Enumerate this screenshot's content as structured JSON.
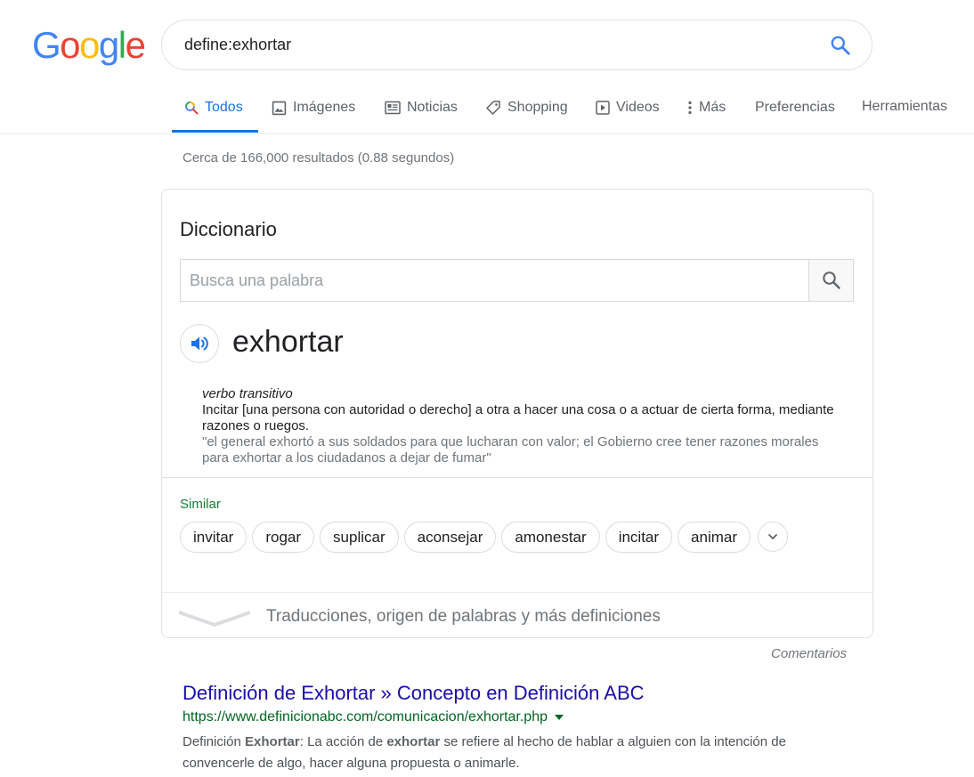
{
  "logo": {
    "letters": [
      "G",
      "o",
      "o",
      "g",
      "l",
      "e"
    ],
    "colors": [
      "#4285F4",
      "#EA4335",
      "#FBBC05",
      "#4285F4",
      "#34A853",
      "#EA4335"
    ]
  },
  "search": {
    "query": "define:exhortar"
  },
  "tabs": [
    {
      "label": "Todos",
      "icon": "search-icon",
      "active": true
    },
    {
      "label": "Imágenes",
      "icon": "image-icon"
    },
    {
      "label": "Noticias",
      "icon": "news-icon"
    },
    {
      "label": "Shopping",
      "icon": "tag-icon"
    },
    {
      "label": "Videos",
      "icon": "play-icon"
    },
    {
      "label": "Más",
      "icon": "more-vert-icon"
    },
    {
      "label": "Preferencias"
    },
    {
      "label": "Herramientas"
    }
  ],
  "stats": "Cerca de 166,000 resultados (0.88 segundos)",
  "dictionary": {
    "title": "Diccionario",
    "placeholder": "Busca una palabra",
    "word": "exhortar",
    "part_of_speech": "verbo transitivo",
    "definition": "Incitar [una persona con autoridad o derecho] a otra a hacer una cosa o a actuar de cierta forma, mediante razones o ruegos.",
    "example": "\"el general exhortó a sus soldados para que lucharan con valor; el Gobierno cree tener razones morales para exhortar a los ciudadanos a dejar de fumar\"",
    "similar_label": "Similar",
    "similar": [
      "invitar",
      "rogar",
      "suplicar",
      "aconsejar",
      "amonestar",
      "incitar",
      "animar"
    ],
    "more_label": "Traducciones, origen de palabras y más definiciones"
  },
  "feedback": "Comentarios",
  "result": {
    "title": "Definición de Exhortar » Concepto en Definición ABC",
    "url": "https://www.definicionabc.com/comunicacion/exhortar.php",
    "snippet_parts": [
      {
        "text": "Definición ",
        "bold": false
      },
      {
        "text": "Exhortar",
        "bold": true
      },
      {
        "text": ": La acción de ",
        "bold": false
      },
      {
        "text": "exhortar",
        "bold": true
      },
      {
        "text": " se refiere al hecho de hablar a alguien con la intención de convencerle de algo, hacer alguna propuesta o animarle.",
        "bold": false
      }
    ]
  },
  "colors": {
    "link": "#1a0dab",
    "url": "#006621",
    "accent": "#1a73e8",
    "similar": "#188038"
  }
}
